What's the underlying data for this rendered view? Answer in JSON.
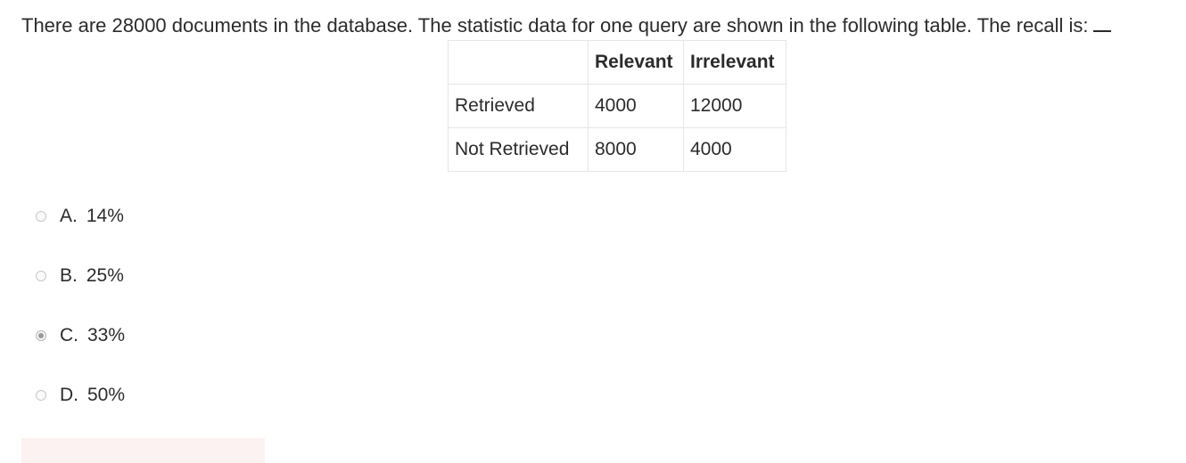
{
  "question": {
    "text": "There are 28000 documents in the database. The statistic data for one query are shown in the following table. The recall is:"
  },
  "table": {
    "headers": [
      "",
      "Relevant",
      "Irrelevant"
    ],
    "rows": [
      {
        "label": "Retrieved",
        "relevant": "4000",
        "irrelevant": "12000"
      },
      {
        "label": "Not Retrieved",
        "relevant": "8000",
        "irrelevant": "4000"
      }
    ]
  },
  "options": [
    {
      "letter": "A.",
      "text": "14%",
      "selected": false
    },
    {
      "letter": "B.",
      "text": "25%",
      "selected": false
    },
    {
      "letter": "C.",
      "text": "33%",
      "selected": true
    },
    {
      "letter": "D.",
      "text": "50%",
      "selected": false
    }
  ],
  "colors": {
    "text": "#2b2b2b",
    "border": "#e6e6e6",
    "radio_selected": "#9a9a9a",
    "feedback_bg": "#fdf2f2"
  }
}
